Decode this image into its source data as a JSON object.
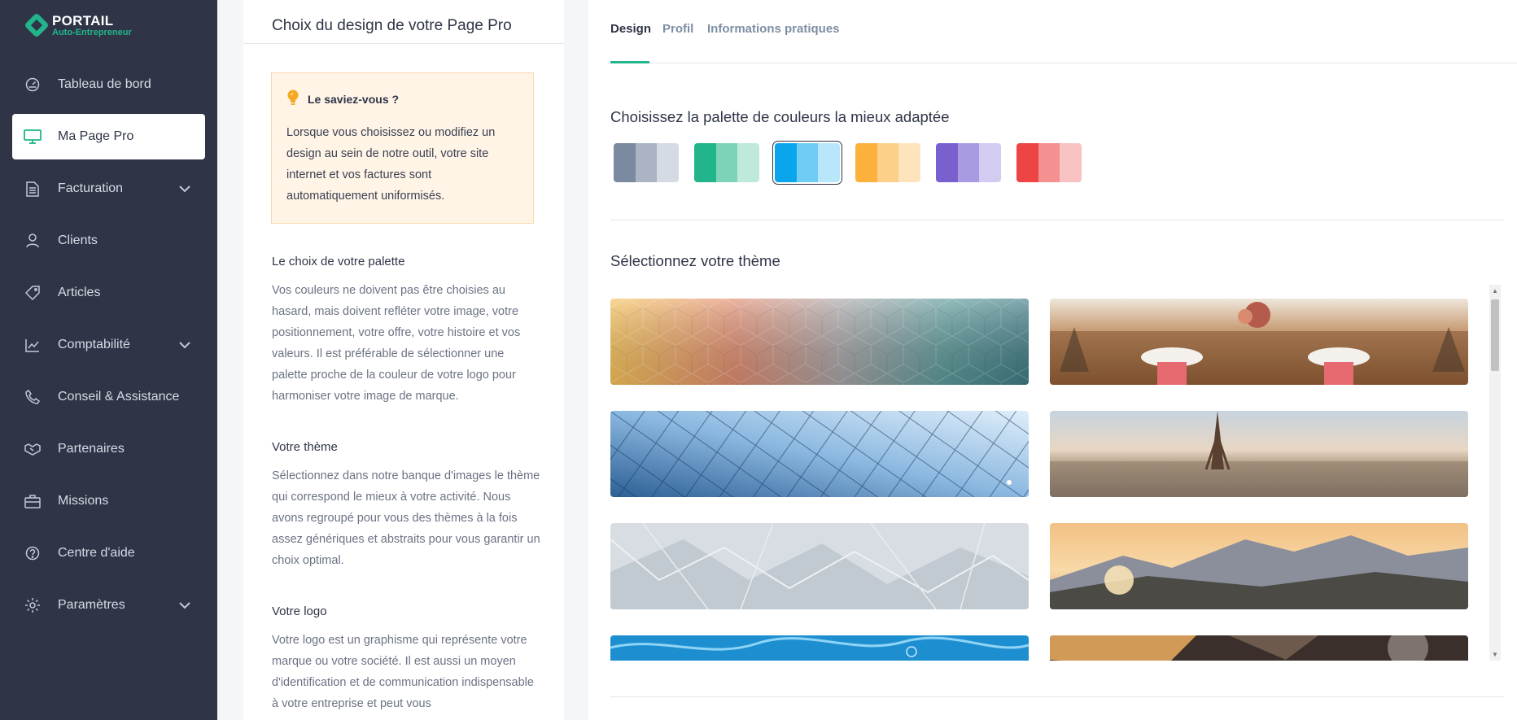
{
  "brand": {
    "title": "PORTAIL",
    "subtitle": "Auto-Entrepreneur"
  },
  "sidebar": {
    "items": [
      {
        "label": "Tableau de bord",
        "icon": "dashboard-icon"
      },
      {
        "label": "Ma Page Pro",
        "icon": "monitor-icon",
        "active": true
      },
      {
        "label": "Facturation",
        "icon": "document-icon",
        "expandable": true
      },
      {
        "label": "Clients",
        "icon": "user-icon"
      },
      {
        "label": "Articles",
        "icon": "tag-icon"
      },
      {
        "label": "Comptabilité",
        "icon": "chart-icon",
        "expandable": true
      },
      {
        "label": "Conseil & Assistance",
        "icon": "phone-icon"
      },
      {
        "label": "Partenaires",
        "icon": "handshake-icon"
      },
      {
        "label": "Missions",
        "icon": "briefcase-icon"
      },
      {
        "label": "Centre d'aide",
        "icon": "help-icon"
      },
      {
        "label": "Paramètres",
        "icon": "gear-icon",
        "expandable": true
      }
    ]
  },
  "info": {
    "title": "Choix du design de votre Page Pro",
    "tip_title": "Le saviez-vous ?",
    "tip_text": "Lorsque vous choisissez ou modifiez un design au sein de notre outil, votre site internet et vos factures sont automatiquement uniformisés.",
    "sections": [
      {
        "title": "Le choix de votre palette",
        "text": "Vos couleurs ne doivent pas être choisies au hasard, mais doivent refléter votre image, votre positionnement, votre offre, votre histoire et vos valeurs. Il est préférable de sélectionner une palette proche de la couleur de votre logo pour harmoniser votre image de marque."
      },
      {
        "title": "Votre thème",
        "text": "Sélectionnez dans notre banque d'images le thème qui correspond le mieux à votre activité. Nous avons regroupé pour vous des thèmes à la fois assez génériques et abstraits pour vous garantir un choix optimal."
      },
      {
        "title": "Votre logo",
        "text": "Votre logo est un graphisme qui représente votre marque ou votre société. Il est aussi un moyen d'identification et de communication indispensable à votre entreprise et peut vous"
      }
    ]
  },
  "tabs": [
    {
      "label": "Design",
      "active": true
    },
    {
      "label": "Profil"
    },
    {
      "label": "Informations pratiques"
    }
  ],
  "palette": {
    "heading": "Choisissez la palette de couleurs la mieux adaptée",
    "selected_index": 2,
    "options": [
      [
        "#7b8aa0",
        "#aab4c3",
        "#d5dbe3"
      ],
      [
        "#22b58b",
        "#7dd3b8",
        "#bfe9da"
      ],
      [
        "#0ba5ec",
        "#6fcdf5",
        "#b8e6fb"
      ],
      [
        "#fbb13c",
        "#fdd08a",
        "#fde4bd"
      ],
      [
        "#7a5fcf",
        "#aa9ae2",
        "#d3cbf1"
      ],
      [
        "#ee4444",
        "#f49090",
        "#f9c2c2"
      ]
    ]
  },
  "themes": {
    "heading": "Sélectionnez votre thème",
    "items": [
      {
        "name": "geometric-hexagons"
      },
      {
        "name": "dinner-table"
      },
      {
        "name": "glass-building"
      },
      {
        "name": "paris-eiffel"
      },
      {
        "name": "white-polygons"
      },
      {
        "name": "mountains-sunset"
      },
      {
        "name": "blue-water"
      },
      {
        "name": "workshop-tools"
      }
    ]
  }
}
